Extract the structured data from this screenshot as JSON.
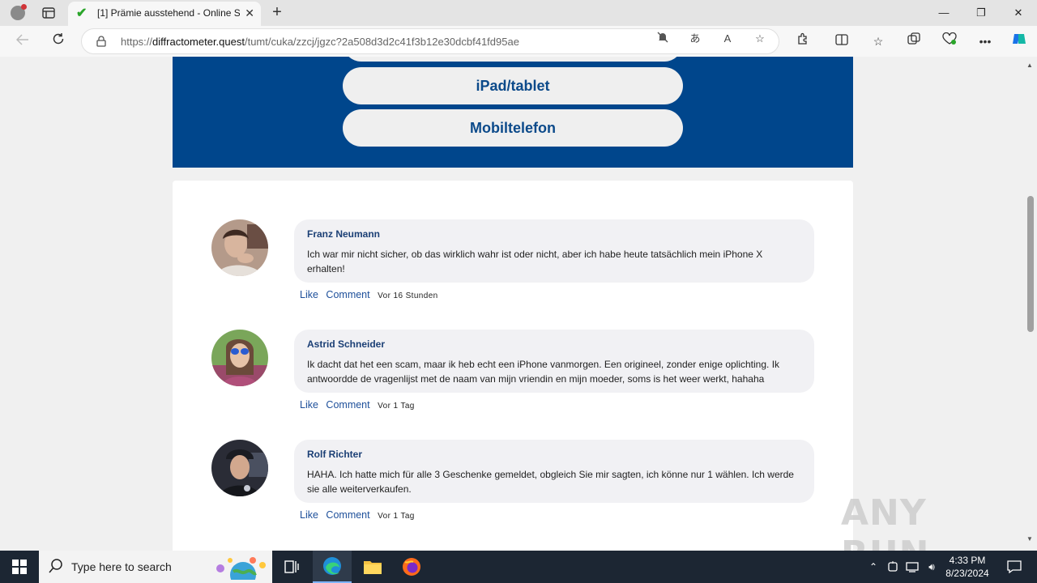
{
  "browser": {
    "tab_title": "[1] Prämie ausstehend - Online S",
    "url_prefix": "https://",
    "url_domain": "diffractometer.quest",
    "url_path": "/tumt/cuka/zzcj/jgzc?2a508d3d2c41f3b12e30dcbf41fd95ae",
    "new_tab": "+",
    "close_tab": "✕",
    "minimize": "—",
    "maximize": "❐",
    "close_window": "✕"
  },
  "options": [
    {
      "label": "iPad/tablet"
    },
    {
      "label": "Mobiltelefon"
    }
  ],
  "comments": [
    {
      "name": "Franz Neumann",
      "text": "Ich war mir nicht sicher, ob das wirklich wahr ist oder nicht, aber ich habe heute tatsächlich mein iPhone X erhalten!",
      "like": "Like",
      "comment": "Comment",
      "time": "Vor 16 Stunden"
    },
    {
      "name": "Astrid Schneider",
      "text": "Ik dacht dat het een scam, maar ik heb echt een iPhone vanmorgen. Een origineel, zonder enige oplichting. Ik antwoordde de vragenlijst met de naam van mijn vriendin en mijn moeder, soms is het weer werkt, hahaha",
      "like": "Like",
      "comment": "Comment",
      "time": "Vor 1 Tag"
    },
    {
      "name": "Rolf Richter",
      "text": "HAHA. Ich hatte mich für alle 3 Geschenke gemeldet, obgleich Sie mir sagten, ich könne nur 1 wählen. Ich werde sie alle weiterverkaufen.",
      "like": "Like",
      "comment": "Comment",
      "time": "Vor 1 Tag"
    }
  ],
  "watermark": "ANY RUN",
  "taskbar": {
    "search_placeholder": "Type here to search",
    "time": "4:33 PM",
    "date": "8/23/2024"
  },
  "colors": {
    "panel_blue": "#00468c",
    "name_blue": "#1b3f75",
    "link_blue": "#1d4f9a",
    "taskbar": "#1c2633"
  }
}
